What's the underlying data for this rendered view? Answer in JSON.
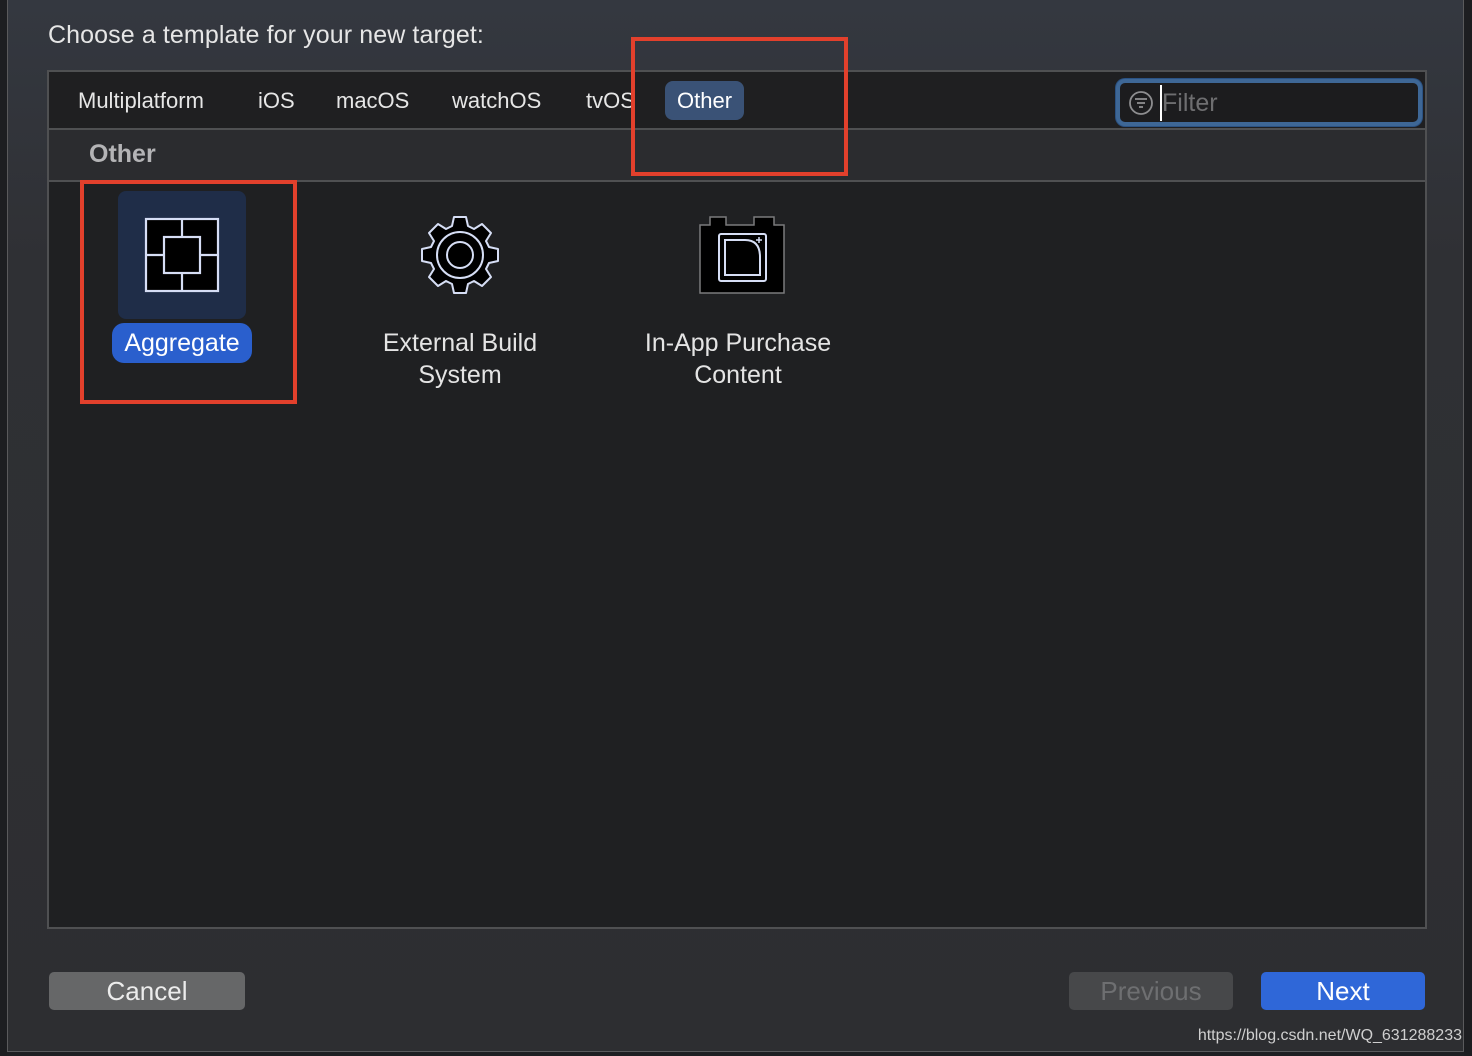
{
  "prompt": "Choose a template for your new target:",
  "tabs": [
    {
      "label": "Multiplatform",
      "active": false
    },
    {
      "label": "iOS",
      "active": false
    },
    {
      "label": "macOS",
      "active": false
    },
    {
      "label": "watchOS",
      "active": false
    },
    {
      "label": "tvOS",
      "active": false
    },
    {
      "label": "Other",
      "active": true
    }
  ],
  "filter": {
    "placeholder": "Filter",
    "value": "",
    "icon": "filter-icon"
  },
  "section": {
    "title": "Other"
  },
  "templates": [
    {
      "label": "Aggregate",
      "icon": "aggregate-icon",
      "selected": true
    },
    {
      "label": "External Build System",
      "label_lines": [
        "External Build",
        "System"
      ],
      "icon": "gear-icon",
      "selected": false
    },
    {
      "label": "In-App Purchase Content",
      "label_lines": [
        "In-App Purchase",
        "Content"
      ],
      "icon": "in-app-purchase-icon",
      "selected": false
    }
  ],
  "buttons": {
    "cancel": "Cancel",
    "previous": "Previous",
    "previous_enabled": false,
    "next": "Next"
  },
  "colors": {
    "accent": "#2f67d8",
    "active_tab": "#3a5276",
    "annotation": "#e2402c"
  },
  "watermark": "https://blog.csdn.net/WQ_631288233"
}
